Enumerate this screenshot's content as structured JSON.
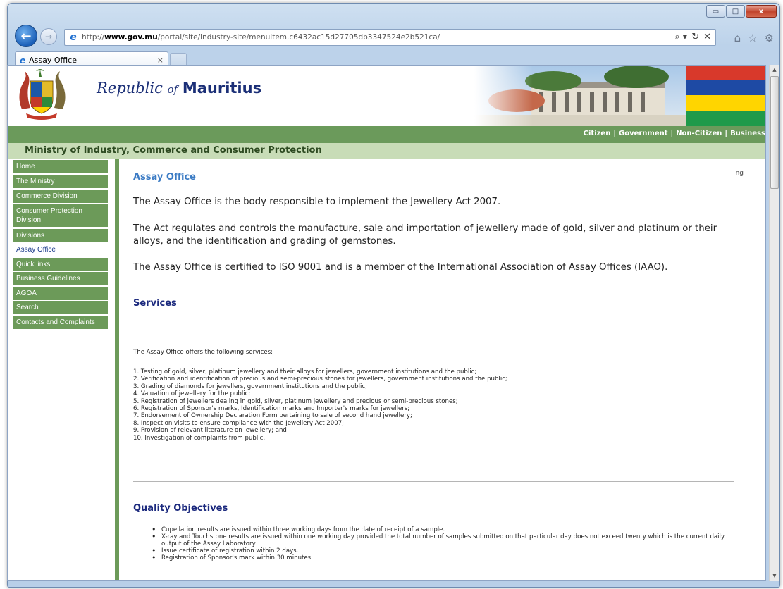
{
  "browser": {
    "url_prefix": "http://",
    "url_domain": "www.gov.mu",
    "url_path": "/portal/site/industry-site/menuitem.c6432ac15d27705db3347524e2b521ca/",
    "tab_title": "Assay Office",
    "tab_close": "×",
    "search_glyph": "⌕ ▾",
    "refresh_glyph": "↻",
    "stop_glyph": "✕",
    "home_glyph": "⌂",
    "fav_glyph": "☆",
    "tools_glyph": "⚙",
    "minimize": "▭",
    "maximize": "□",
    "close": "x"
  },
  "site": {
    "title_prefix": "Republic",
    "title_of": "of",
    "title_country": "Mauritius",
    "audience_links": [
      "Citizen",
      "Government",
      "Non-Citizen",
      "Business"
    ],
    "ministry": "Ministry of Industry, Commerce and Consumer Protection"
  },
  "sidebar": {
    "items": [
      {
        "label": "Home"
      },
      {
        "label": "The Ministry"
      },
      {
        "label": "Commerce Division"
      },
      {
        "label": "Consumer Protection Division"
      },
      {
        "label": "Divisions"
      },
      {
        "label": "Assay Office"
      },
      {
        "label": "Quick links"
      },
      {
        "label": "Business Guidelines"
      },
      {
        "label": "AGOA"
      },
      {
        "label": "Search"
      },
      {
        "label": "Contacts and Complaints"
      }
    ]
  },
  "content": {
    "stray_text": "ng",
    "heading": "Assay Office",
    "para1": "The Assay Office is the body responsible to implement the Jewellery Act 2007.",
    "para2": "The Act regulates and controls the manufacture, sale and importation of jewellery made of gold, silver and platinum or their alloys, and the identification and grading of gemstones.",
    "para3": "The Assay Office is certified to ISO 9001 and is a member of the International Association of Assay Offices (IAAO).",
    "services_heading": "Services",
    "services_intro": "The Assay Office offers the following services:",
    "services": [
      "1. Testing of gold, silver, platinum jewellery and their alloys for jewellers, government institutions and the public;",
      "2. Verification and identification of precious and semi-precious stones for jewellers, government institutions and the public;",
      "3. Grading of diamonds for jewellers, government institutions and the public;",
      "4. Valuation of jewellery for the public;",
      "5. Registration of jewellers dealing in gold, silver, platinum jewellery and precious or semi-precious stones;",
      "6. Registration of Sponsor's marks, Identification marks and Importer's marks for jewellers;",
      "7. Endorsement of Ownership Declaration Form pertaining to sale of second hand jewellery;",
      "8. Inspection visits to ensure compliance with the Jewellery Act 2007;",
      "9. Provision of relevant literature on jewellery; and",
      "10. Investigation of complaints from public."
    ],
    "objectives_heading": "Quality Objectives",
    "objectives": [
      "Cupellation results are issued within three working days from the date of receipt of a sample.",
      "X-ray and Touchstone results are issued within one working day provided the total number of samples submitted on that particular day does not exceed twenty which is the current daily output of the Assay Laboratory",
      "Issue certificate of registration within 2 days.",
      "Registration of Sponsor's mark within 30 minutes"
    ]
  },
  "colors": {
    "nav_green": "#6c9a59",
    "ministry_band": "#c8dcb7",
    "heading_blue": "#3b7bc4",
    "section_navy": "#1c2a7e"
  }
}
